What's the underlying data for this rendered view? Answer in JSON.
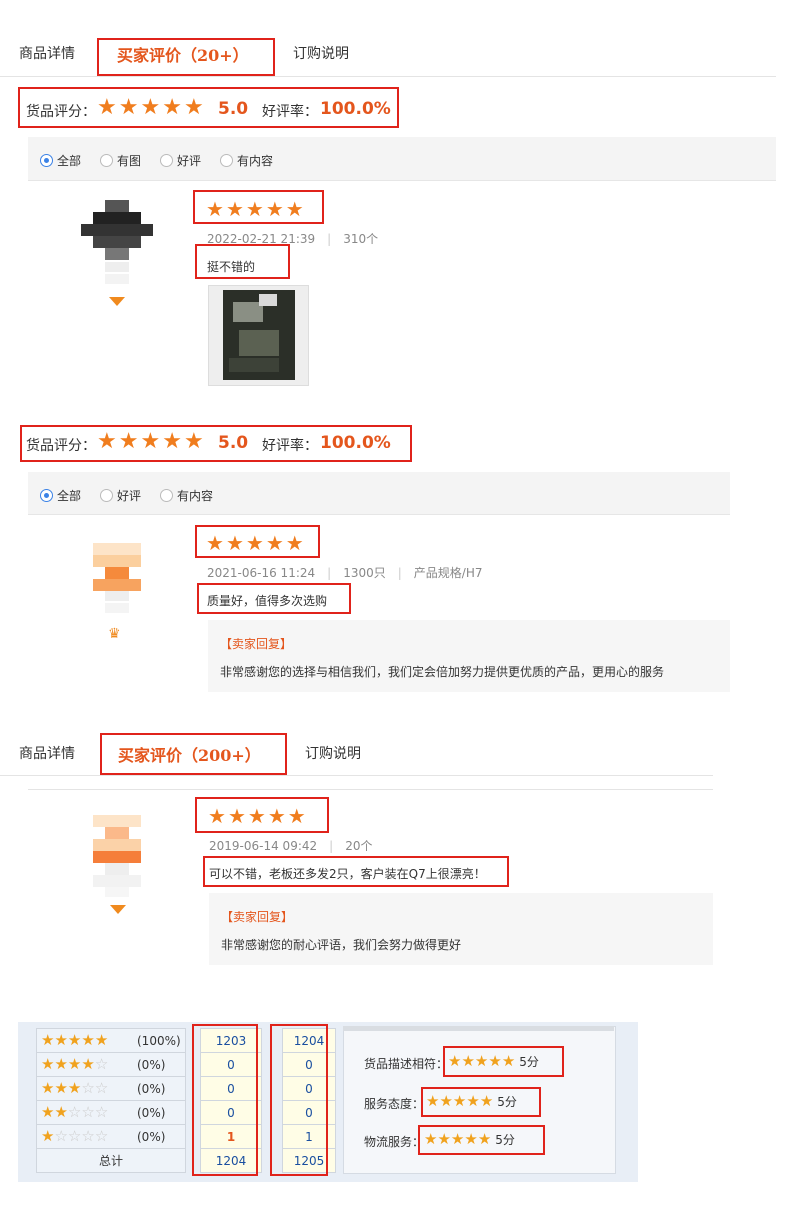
{
  "section1": {
    "tabs": {
      "details": "商品详情",
      "reviews": "买家评价（20+）",
      "order": "订购说明"
    },
    "rating": {
      "label": "货品评分：",
      "score": "5.0",
      "good_label": "好评率：",
      "good_rate": "100.0%"
    },
    "filters": [
      "全部",
      "有图",
      "好评",
      "有内容"
    ],
    "review": {
      "date": "2022-02-21 21:39",
      "qty": "310个",
      "text": "挺不错的"
    }
  },
  "section2": {
    "rating": {
      "label": "货品评分：",
      "score": "5.0",
      "good_label": "好评率：",
      "good_rate": "100.0%"
    },
    "filters": [
      "全部",
      "好评",
      "有内容"
    ],
    "review": {
      "date": "2021-06-16 11:24",
      "qty": "1300只",
      "spec": "产品规格/H7",
      "text": "质量好，值得多次选购",
      "reply_title": "【卖家回复】",
      "reply_text": "非常感谢您的选择与相信我们，我们定会倍加努力提供更优质的产品，更用心的服务"
    }
  },
  "section3": {
    "tabs": {
      "details": "商品详情",
      "reviews": "买家评价（200+）",
      "order": "订购说明"
    },
    "review": {
      "date": "2019-06-14 09:42",
      "qty": "20个",
      "text": "可以不错，老板还多发2只，客户装在Q7上很漂亮！",
      "reply_title": "【卖家回复】",
      "reply_text": "非常感谢您的耐心评语，我们会努力做得更好"
    }
  },
  "summary": {
    "rows": [
      {
        "stars": 5,
        "pct": "(100%)",
        "a": "1203",
        "b": "1204"
      },
      {
        "stars": 4,
        "pct": "(0%)",
        "a": "0",
        "b": "0"
      },
      {
        "stars": 3,
        "pct": "(0%)",
        "a": "0",
        "b": "0"
      },
      {
        "stars": 2,
        "pct": "(0%)",
        "a": "0",
        "b": "0"
      },
      {
        "stars": 1,
        "pct": "(0%)",
        "a": "1",
        "b": "1"
      }
    ],
    "total_label": "总计",
    "total_a": "1204",
    "total_b": "1205",
    "desc_label": "货品描述相符：",
    "desc_score": "5分",
    "service_label": "服务态度：",
    "service_score": "5分",
    "logistics_label": "物流服务：",
    "logistics_score": "5分"
  },
  "colors": {
    "accent": "#e4561d",
    "star": "#f07d1e",
    "highlight_box": "#e0231b"
  }
}
